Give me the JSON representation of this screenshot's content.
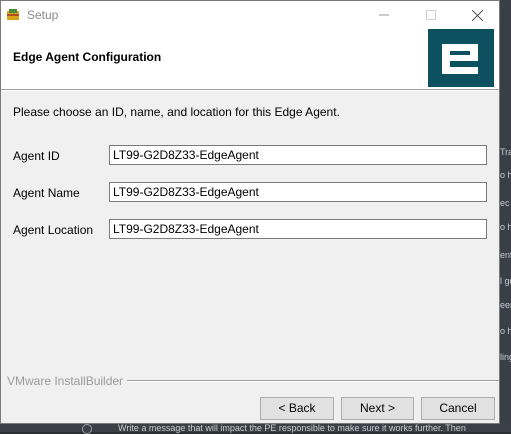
{
  "window": {
    "title": "Setup"
  },
  "header": {
    "title": "Edge Agent Configuration",
    "logo_icon": "edge-logo-icon",
    "logo_color": "#0d5060"
  },
  "form": {
    "prompt": "Please choose an ID, name, and location for this Edge Agent.",
    "fields": [
      {
        "label": "Agent ID",
        "value": "LT99-G2D8Z33-EdgeAgent"
      },
      {
        "label": "Agent Name",
        "value": "LT99-G2D8Z33-EdgeAgent"
      },
      {
        "label": "Agent Location",
        "value": "LT99-G2D8Z33-EdgeAgent"
      }
    ]
  },
  "footer": {
    "brand": "VMware InstallBuilder"
  },
  "buttons": {
    "back": "< Back",
    "next": "Next >",
    "cancel": "Cancel"
  },
  "background_app": {
    "side_snippets": [
      "Tra",
      "o h",
      "ec",
      "o h",
      "ent",
      "l go",
      "eem",
      "o h",
      "ling"
    ],
    "bottom_snippet": "Write a message that will impact the PE responsible to make sure it works further. Then"
  }
}
